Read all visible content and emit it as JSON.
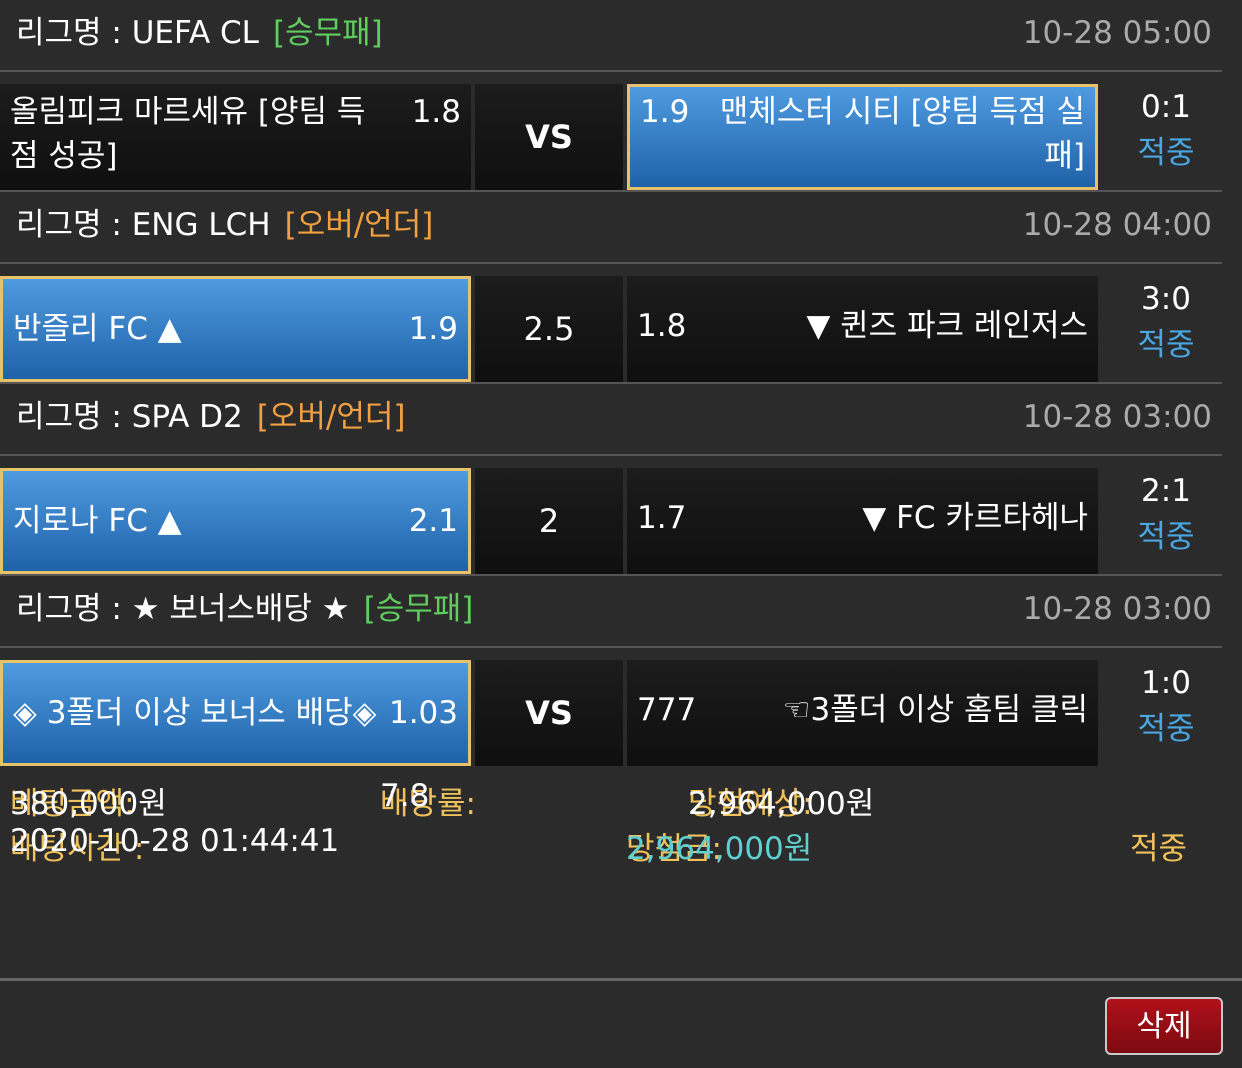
{
  "bets": [
    {
      "league_label": "리그명 : UEFA CL",
      "bet_type": "[승무패]",
      "bet_type_color": "#5fce5f",
      "time": "10-28 05:00",
      "home_team_line1": "올림피크 마르세유 [양팀 득",
      "home_team_line2": "점 성공]",
      "home_odd": "1.8",
      "middle": "VS",
      "away_odd": "1.9",
      "away_team_line1": "맨체스터 시티 [양팀 득점 실",
      "away_team_line2": "패]",
      "score": "0:1",
      "result": "적중",
      "selected": "away"
    },
    {
      "league_label": "리그명 : ENG LCH",
      "bet_type": "[오버/언더]",
      "bet_type_color": "#f0a040",
      "time": "10-28 04:00",
      "home_team": "반즐리 FC ▲",
      "home_odd": "1.9",
      "middle": "2.5",
      "away_odd": "1.8",
      "away_team": "▼ 퀸즈 파크 레인저스",
      "score": "3:0",
      "result": "적중",
      "selected": "home"
    },
    {
      "league_label": "리그명 : SPA D2",
      "bet_type": "[오버/언더]",
      "bet_type_color": "#f0a040",
      "time": "10-28 03:00",
      "home_team": "지로나 FC ▲",
      "home_odd": "2.1",
      "middle": "2",
      "away_odd": "1.7",
      "away_team": "▼ FC 카르타헤나",
      "score": "2:1",
      "result": "적중",
      "selected": "home"
    },
    {
      "league_label": "리그명 : ★ 보너스배당 ★",
      "bet_type": "[승무패]",
      "bet_type_color": "#5fce5f",
      "time": "10-28 03:00",
      "home_team": "◈ 3폴더 이상 보너스 배당◈",
      "home_odd": "1.03",
      "middle": "VS",
      "away_odd": "777",
      "away_team": "☜3폴더 이상 홈팀 클릭",
      "score": "1:0",
      "result": "적중",
      "selected": "home"
    }
  ],
  "summary": {
    "bet_amount_label": "베팅금액:",
    "bet_amount_value": "380,000원",
    "odds_label": "배당률:",
    "odds_value": "7.8",
    "expected_label": "당첨예상:",
    "expected_value": "2,964,000원",
    "bet_time_label": "배팅시간 :",
    "bet_time_value": "2020-10-28 01:44:41",
    "win_label": "당첨금:",
    "win_value": "2,964,000원",
    "status": "적중"
  },
  "delete_label": "삭제"
}
